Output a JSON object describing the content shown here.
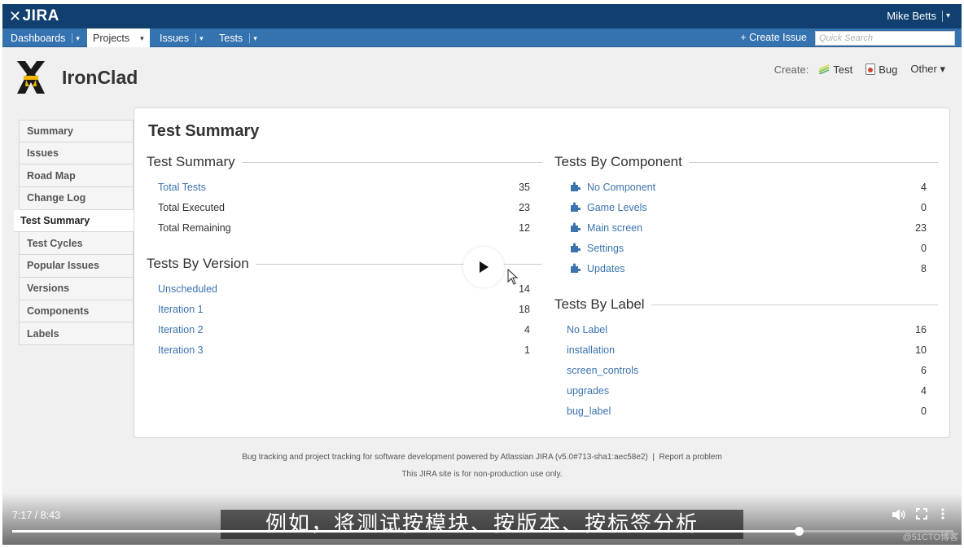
{
  "header": {
    "logo_text": "JIRA",
    "user": "Mike Betts",
    "user_caret": "▾"
  },
  "nav": {
    "items": [
      {
        "label": "Dashboards",
        "caret": "▾"
      },
      {
        "label": "Projects",
        "caret": "▾"
      },
      {
        "label": "Issues",
        "caret": "▾"
      },
      {
        "label": "Tests",
        "caret": "▾"
      }
    ],
    "active_item": "Projects",
    "create_issue": "+ Create Issue",
    "search_placeholder": "Quick Search"
  },
  "project": {
    "name": "IronClad",
    "create_label": "Create:",
    "create_buttons": [
      "Test",
      "Bug"
    ],
    "other_label": "Other ▾"
  },
  "sidebar": {
    "items": [
      "Summary",
      "Issues",
      "Road Map",
      "Change Log",
      "Test Summary",
      "Test Cycles",
      "Popular Issues",
      "Versions",
      "Components",
      "Labels"
    ],
    "active": "Test Summary"
  },
  "main": {
    "title": "Test Summary",
    "test_summary": {
      "heading": "Test Summary",
      "rows": [
        {
          "label": "Total Tests",
          "value": "35",
          "link": true
        },
        {
          "label": "Total Executed",
          "value": "23",
          "link": false
        },
        {
          "label": "Total Remaining",
          "value": "12",
          "link": false
        }
      ]
    },
    "by_version": {
      "heading": "Tests By Version",
      "rows": [
        {
          "label": "Unscheduled",
          "value": "14"
        },
        {
          "label": "Iteration 1",
          "value": "18"
        },
        {
          "label": "Iteration 2",
          "value": "4"
        },
        {
          "label": "Iteration 3",
          "value": "1"
        }
      ]
    },
    "by_component": {
      "heading": "Tests By Component",
      "rows": [
        {
          "label": "No Component",
          "value": "4"
        },
        {
          "label": "Game Levels",
          "value": "0"
        },
        {
          "label": "Main screen",
          "value": "23"
        },
        {
          "label": "Settings",
          "value": "0"
        },
        {
          "label": "Updates",
          "value": "8"
        }
      ]
    },
    "by_label": {
      "heading": "Tests By Label",
      "rows": [
        {
          "label": "No Label",
          "value": "16"
        },
        {
          "label": "installation",
          "value": "10"
        },
        {
          "label": "screen_controls",
          "value": "6"
        },
        {
          "label": "upgrades",
          "value": "4"
        },
        {
          "label": "bug_label",
          "value": "0"
        }
      ]
    }
  },
  "footer": {
    "line1": "Bug tracking and project tracking for software development powered by Atlassian JIRA (v5.0#713-sha1:aec58e2)",
    "report": "Report a problem",
    "line2": "This JIRA site is for non-production use only."
  },
  "video": {
    "time": "7:17 / 8:43",
    "progress": 0.836,
    "subtitle": "例如，将测试按模块、按版本、按标签分析",
    "watermark": "@51CTO博客"
  },
  "colors": {
    "header": "#114070",
    "nav": "#3572b0",
    "link": "#3b73af"
  }
}
